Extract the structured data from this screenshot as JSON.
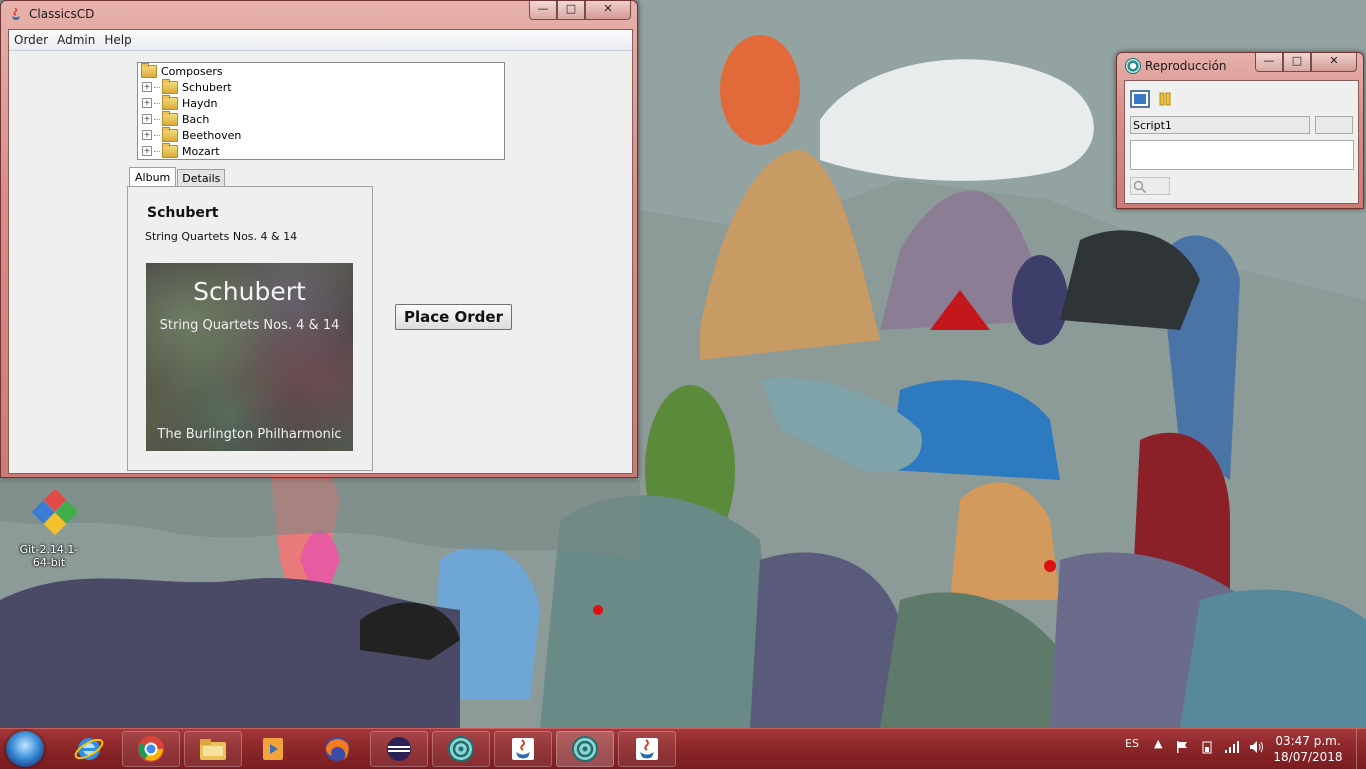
{
  "classics_window": {
    "title": "ClassicsCD",
    "menu": [
      "Order",
      "Admin",
      "Help"
    ],
    "tree": {
      "root": "Composers",
      "children": [
        "Schubert",
        "Haydn",
        "Bach",
        "Beethoven",
        "Mozart"
      ]
    },
    "tabs": [
      "Album",
      "Details"
    ],
    "album": {
      "composer": "Schubert",
      "title": "String Quartets Nos. 4 & 14",
      "cover_name": "Schubert",
      "cover_subtitle": "String Quartets Nos. 4 & 14",
      "cover_performer": "The Burlington Philharmonic"
    },
    "place_order_label": "Place Order"
  },
  "repro_window": {
    "title": "Reproducción",
    "script_value": "Script1"
  },
  "desktop": {
    "icon_label": "Git-2.14.1-64-bit"
  },
  "taskbar": {
    "language": "ES",
    "time": "03:47 p.m.",
    "date": "18/07/2018"
  },
  "caption_icons": {
    "minimize": "minimize-icon",
    "maximize": "maximize-icon",
    "close": "close-icon"
  },
  "colors": {
    "window_frame": "#d88e88",
    "taskbar": "#8a2528",
    "client": "#efefef"
  }
}
